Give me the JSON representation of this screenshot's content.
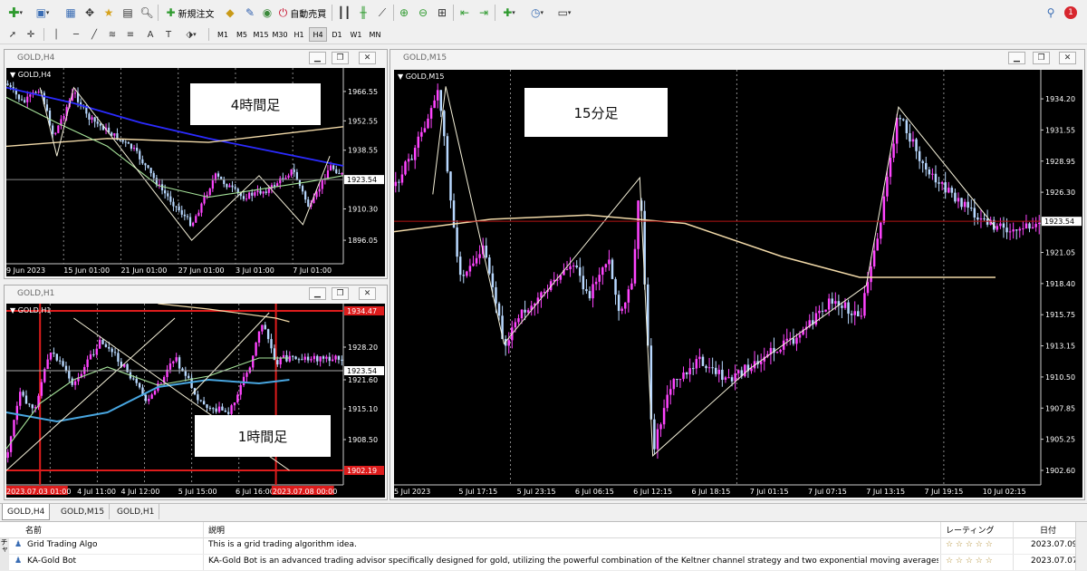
{
  "toolbar": {
    "new_order": "新規注文",
    "auto_trading": "自動売買",
    "notification_count": "1",
    "timeframes": [
      "M1",
      "M5",
      "M15",
      "M30",
      "H1",
      "H4",
      "D1",
      "W1",
      "MN"
    ],
    "active_timeframe": "H4",
    "text_tool": "A",
    "trend_tool": "T"
  },
  "windows": {
    "h4": {
      "title": "GOLD,H4",
      "symbol_label": "GOLD,H4",
      "annotation": "4時間足",
      "price_labels": [
        "1966.55",
        "1952.55",
        "1938.55",
        "1923.54",
        "1910.30",
        "1896.05"
      ],
      "current_price": "1923.54",
      "time_labels": [
        "9 Jun 2023",
        "15 Jun 01:00",
        "21 Jun 01:00",
        "27 Jun 01:00",
        "3 Jul 01:00",
        "7 Jul 01:00"
      ]
    },
    "h1": {
      "title": "GOLD,H1",
      "symbol_label": "GOLD,H1",
      "annotation": "1時間足",
      "price_labels": [
        "1928.20",
        "1923.54",
        "1921.60",
        "1915.10",
        "1908.50"
      ],
      "current_price": "1923.54",
      "time_labels": [
        "2023.07.03 01:00",
        "4 Jul 11:00",
        "4 Jul 12:00",
        "5 Jul 15:00",
        "6 Jul 16:00",
        "2023.07.08 00:00"
      ],
      "marker_top": "1934.47",
      "marker_bottom": "1902.19"
    },
    "m15": {
      "title": "GOLD,M15",
      "symbol_label": "GOLD,M15",
      "annotation": "15分足",
      "price_labels": [
        "1934.20",
        "1931.55",
        "1928.95",
        "1926.30",
        "1923.54",
        "1921.05",
        "1918.40",
        "1915.75",
        "1913.15",
        "1910.50",
        "1907.85",
        "1905.25",
        "1902.60"
      ],
      "current_price": "1923.54",
      "time_labels": [
        "5 Jul 2023",
        "5 Jul 17:15",
        "5 Jul 23:15",
        "6 Jul 06:15",
        "6 Jul 12:15",
        "6 Jul 18:15",
        "7 Jul 01:15",
        "7 Jul 07:15",
        "7 Jul 13:15",
        "7 Jul 19:15",
        "10 Jul 02:15"
      ]
    }
  },
  "tabs": [
    "GOLD,H4",
    "GOLD,M15",
    "GOLD,H1"
  ],
  "active_tab": "GOLD,H4",
  "table": {
    "headers": {
      "name": "名前",
      "description": "説明",
      "rating": "レーティング",
      "date": "日付"
    },
    "rows": [
      {
        "name": "Grid Trading Algo",
        "description": "This is a grid trading algorithm idea.",
        "rating": "☆ ☆ ☆ ☆ ☆",
        "date": "2023.07.09"
      },
      {
        "name": "KA-Gold Bot",
        "description": "KA-Gold Bot is an advanced trading advisor specifically designed for gold, utilizing the powerful combination of the Keltner channel strategy and two exponential moving averages (EMAs) - the 1...",
        "rating": "☆ ☆ ☆ ☆ ☆",
        "date": "2023.07.07"
      }
    ],
    "side_label": "チャ"
  },
  "colors": {
    "chart_bg": "#000000",
    "candle_up": "#ff44ff",
    "candle_down": "#b8d8ff",
    "ma_blue": "#2b2bff",
    "ma_sand": "#f1d9a8",
    "ma_green": "#a6e39a",
    "ma_teal": "#48a6e0",
    "current_line": "#b41414",
    "marker_red": "#dd1c1c"
  }
}
